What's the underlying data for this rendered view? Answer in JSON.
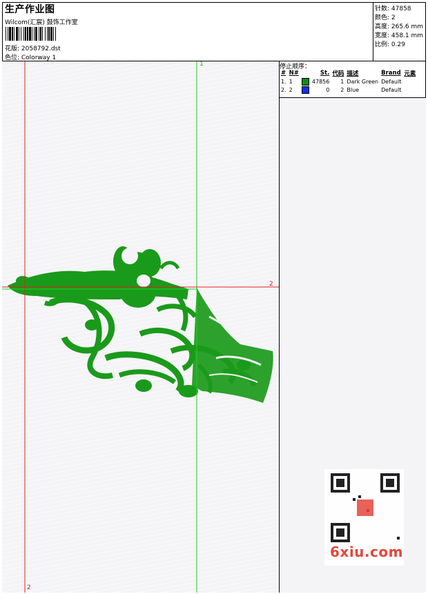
{
  "header": {
    "title": "生产作业图",
    "studio": "Wilcom(汇宸) 鼓饰工作室",
    "design_label": "花版: 2058792.dst",
    "colorway_label": "色位: Colorway 1"
  },
  "stats": {
    "stitches": "针数: 47858",
    "colors": "颜色: 2",
    "height": "高度: 265.6 mm",
    "width": "宽度: 458.1 mm",
    "scale": "比例: 0.29"
  },
  "guides": {
    "vertical_top": "1",
    "vertical_bottom": "2",
    "horizontal_right": "2",
    "colors": {
      "vertical_main": "#22cc22",
      "vertical_left": "#e02020",
      "horizontal": "#e02020"
    }
  },
  "embroidery": {
    "color": "#1a9a1a"
  },
  "stop_sequence": {
    "title": "停止顺序：",
    "headers": [
      "#",
      "N#",
      "St.",
      "代码",
      "描述",
      "Brand",
      "元素"
    ],
    "rows": [
      {
        "num": "1.",
        "n": "1",
        "color": "#138a13",
        "stitches": "47856",
        "code": "1",
        "desc": "Dark Green",
        "brand": "Default"
      },
      {
        "num": "2.",
        "n": "2",
        "color": "#1030e0",
        "stitches": "0",
        "code": "2",
        "desc": "Blue",
        "brand": "Default"
      }
    ]
  },
  "watermark": {
    "text": "6xiu.com"
  }
}
